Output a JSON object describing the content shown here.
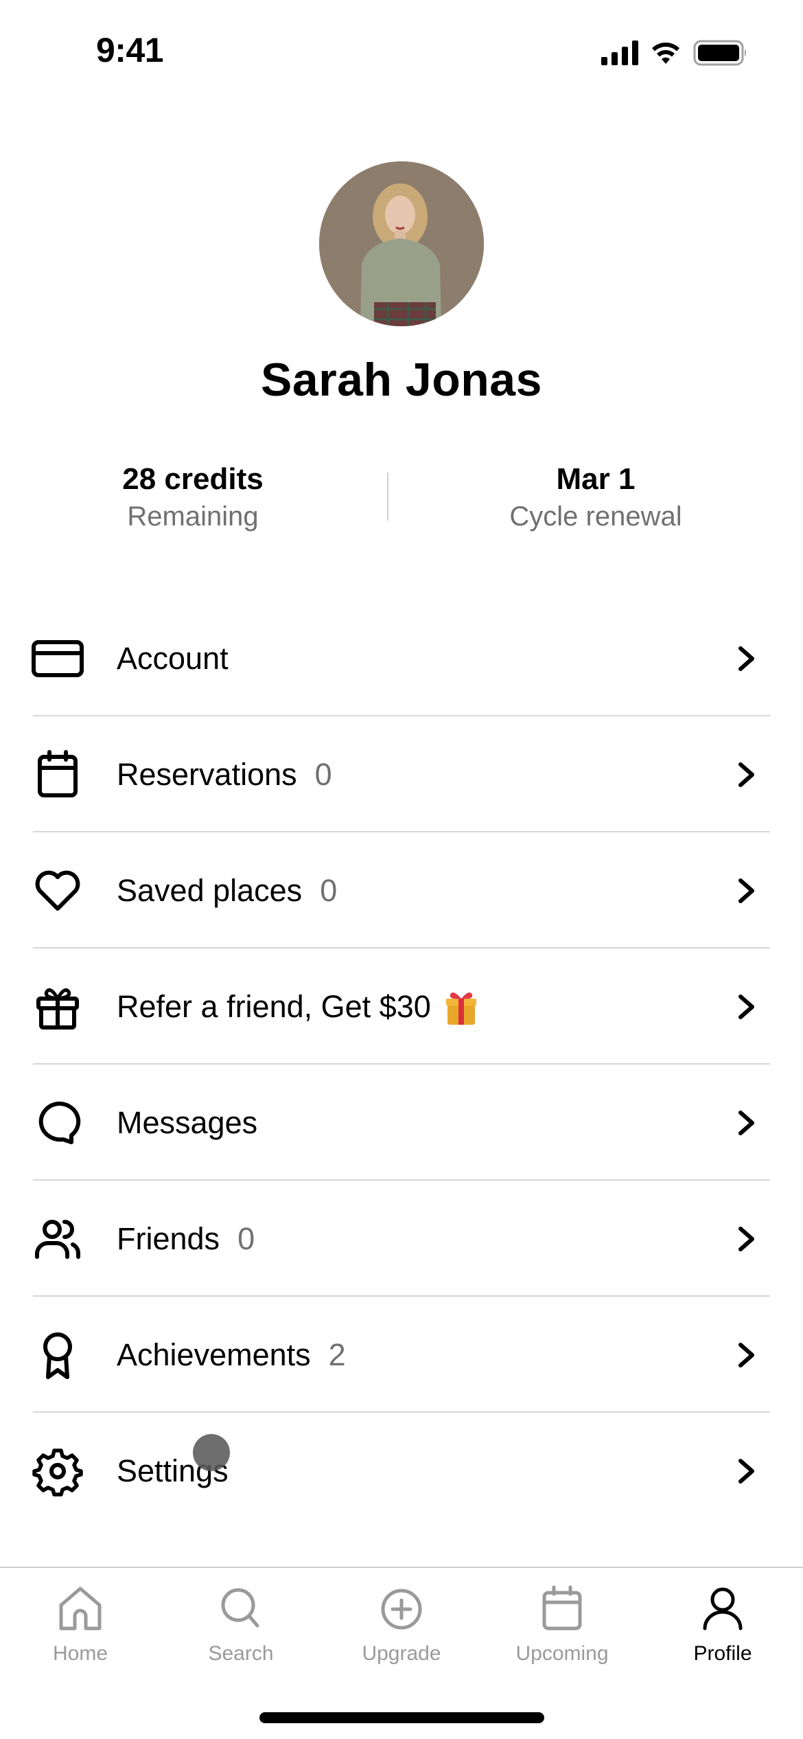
{
  "status_bar": {
    "time": "9:41",
    "icons": [
      "cellular-signal-icon",
      "wifi-icon",
      "battery-icon"
    ]
  },
  "profile": {
    "name": "Sarah Jonas",
    "avatar": "profile-photo"
  },
  "stats": {
    "credits": {
      "value": "28 credits",
      "label": "Remaining"
    },
    "renewal": {
      "value": "Mar 1",
      "label": "Cycle renewal"
    }
  },
  "menu": {
    "items": [
      {
        "label": "Account",
        "count": "",
        "icon": "credit-card-icon"
      },
      {
        "label": "Reservations",
        "count": "0",
        "icon": "calendar-icon"
      },
      {
        "label": "Saved places",
        "count": "0",
        "icon": "heart-icon"
      },
      {
        "label": "Refer a friend, Get $30",
        "count": "",
        "emoji": "🎁",
        "icon": "gift-icon"
      },
      {
        "label": "Messages",
        "count": "",
        "icon": "chat-bubble-icon"
      },
      {
        "label": "Friends",
        "count": "0",
        "icon": "users-icon"
      },
      {
        "label": "Achievements",
        "count": "2",
        "icon": "award-ribbon-icon"
      },
      {
        "label": "Settings",
        "count": "",
        "icon": "gear-icon"
      }
    ]
  },
  "tab_bar": {
    "tabs": [
      {
        "label": "Home",
        "icon": "home-icon",
        "active": false
      },
      {
        "label": "Search",
        "icon": "search-icon",
        "active": false
      },
      {
        "label": "Upgrade",
        "icon": "plus-circle-icon",
        "active": false
      },
      {
        "label": "Upcoming",
        "icon": "calendar-icon",
        "active": false
      },
      {
        "label": "Profile",
        "icon": "person-icon",
        "active": true
      }
    ]
  },
  "colors": {
    "text_primary": "#000000",
    "text_secondary": "#707070",
    "tab_inactive": "#9a9a9a",
    "divider": "#d6d6d6"
  }
}
